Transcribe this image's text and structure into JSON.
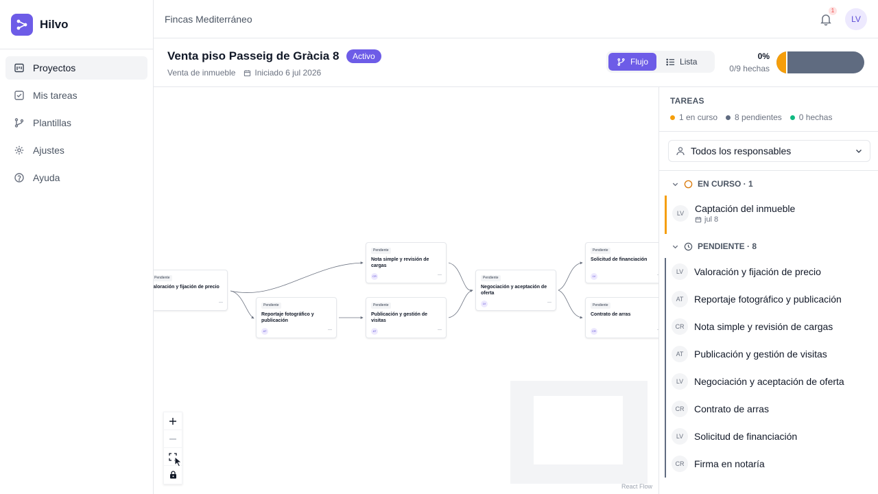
{
  "brand": {
    "name": "Hilvo"
  },
  "sidebar": {
    "items": [
      {
        "label": "Proyectos",
        "icon": "folder-icon",
        "active": true
      },
      {
        "label": "Mis tareas",
        "icon": "check-square-icon",
        "active": false
      },
      {
        "label": "Plantillas",
        "icon": "git-branch-icon",
        "active": false
      },
      {
        "label": "Ajustes",
        "icon": "gear-icon",
        "active": false
      },
      {
        "label": "Ayuda",
        "icon": "help-circle-icon",
        "active": false
      }
    ]
  },
  "topbar": {
    "org": "Fincas Mediterráneo",
    "notifications": "1",
    "user_initials": "LV"
  },
  "project": {
    "title": "Venta piso Passeig de Gràcia 8",
    "status": "Activo",
    "type": "Venta de inmueble",
    "started": "Iniciado 6 jul 2026",
    "views": {
      "flow": "Flujo",
      "list": "Lista",
      "active": "flow"
    },
    "progress": {
      "percent": "0%",
      "count": "0/9 hechas",
      "fraction_done": 0,
      "fraction_in_progress": 0.111
    }
  },
  "flow": {
    "nodes": [
      {
        "status": "Pendiente",
        "title": "Valoración y fijación de precio",
        "avatar": "LV"
      },
      {
        "status": "Pendiente",
        "title": "Nota simple y revisión de cargas",
        "avatar": "CR"
      },
      {
        "status": "Pendiente",
        "title": "Reportaje fotográfico y publicación",
        "avatar": "AT"
      },
      {
        "status": "Pendiente",
        "title": "Publicación y gestión de visitas",
        "avatar": "AT"
      },
      {
        "status": "Pendiente",
        "title": "Negociación y aceptación de oferta",
        "avatar": "LV"
      },
      {
        "status": "Pendiente",
        "title": "Solicitud de financiación",
        "avatar": "LV"
      },
      {
        "status": "Pendiente",
        "title": "Contrato de arras",
        "avatar": "CR"
      }
    ],
    "attribution": "React Flow"
  },
  "tasks_panel": {
    "title": "TAREAS",
    "stats": {
      "curso": "1 en curso",
      "pendientes": "8 pendientes",
      "hechas": "0 hechas"
    },
    "colors": {
      "curso": "#f59e0b",
      "pendiente": "#5f6b80",
      "hecha": "#10b981"
    },
    "filter": "Todos los responsables",
    "groups": {
      "curso": {
        "label": "EN CURSO · 1",
        "items": [
          {
            "avatar": "LV",
            "title": "Captación del inmueble",
            "due": "jul 8"
          }
        ]
      },
      "pendiente": {
        "label": "PENDIENTE · 8",
        "items": [
          {
            "avatar": "LV",
            "title": "Valoración y fijación de precio"
          },
          {
            "avatar": "AT",
            "title": "Reportaje fotográfico y publicación"
          },
          {
            "avatar": "CR",
            "title": "Nota simple y revisión de cargas"
          },
          {
            "avatar": "AT",
            "title": "Publicación y gestión de visitas"
          },
          {
            "avatar": "LV",
            "title": "Negociación y aceptación de oferta"
          },
          {
            "avatar": "CR",
            "title": "Contrato de arras"
          },
          {
            "avatar": "LV",
            "title": "Solicitud de financiación"
          },
          {
            "avatar": "CR",
            "title": "Firma en notaría"
          }
        ]
      }
    }
  }
}
